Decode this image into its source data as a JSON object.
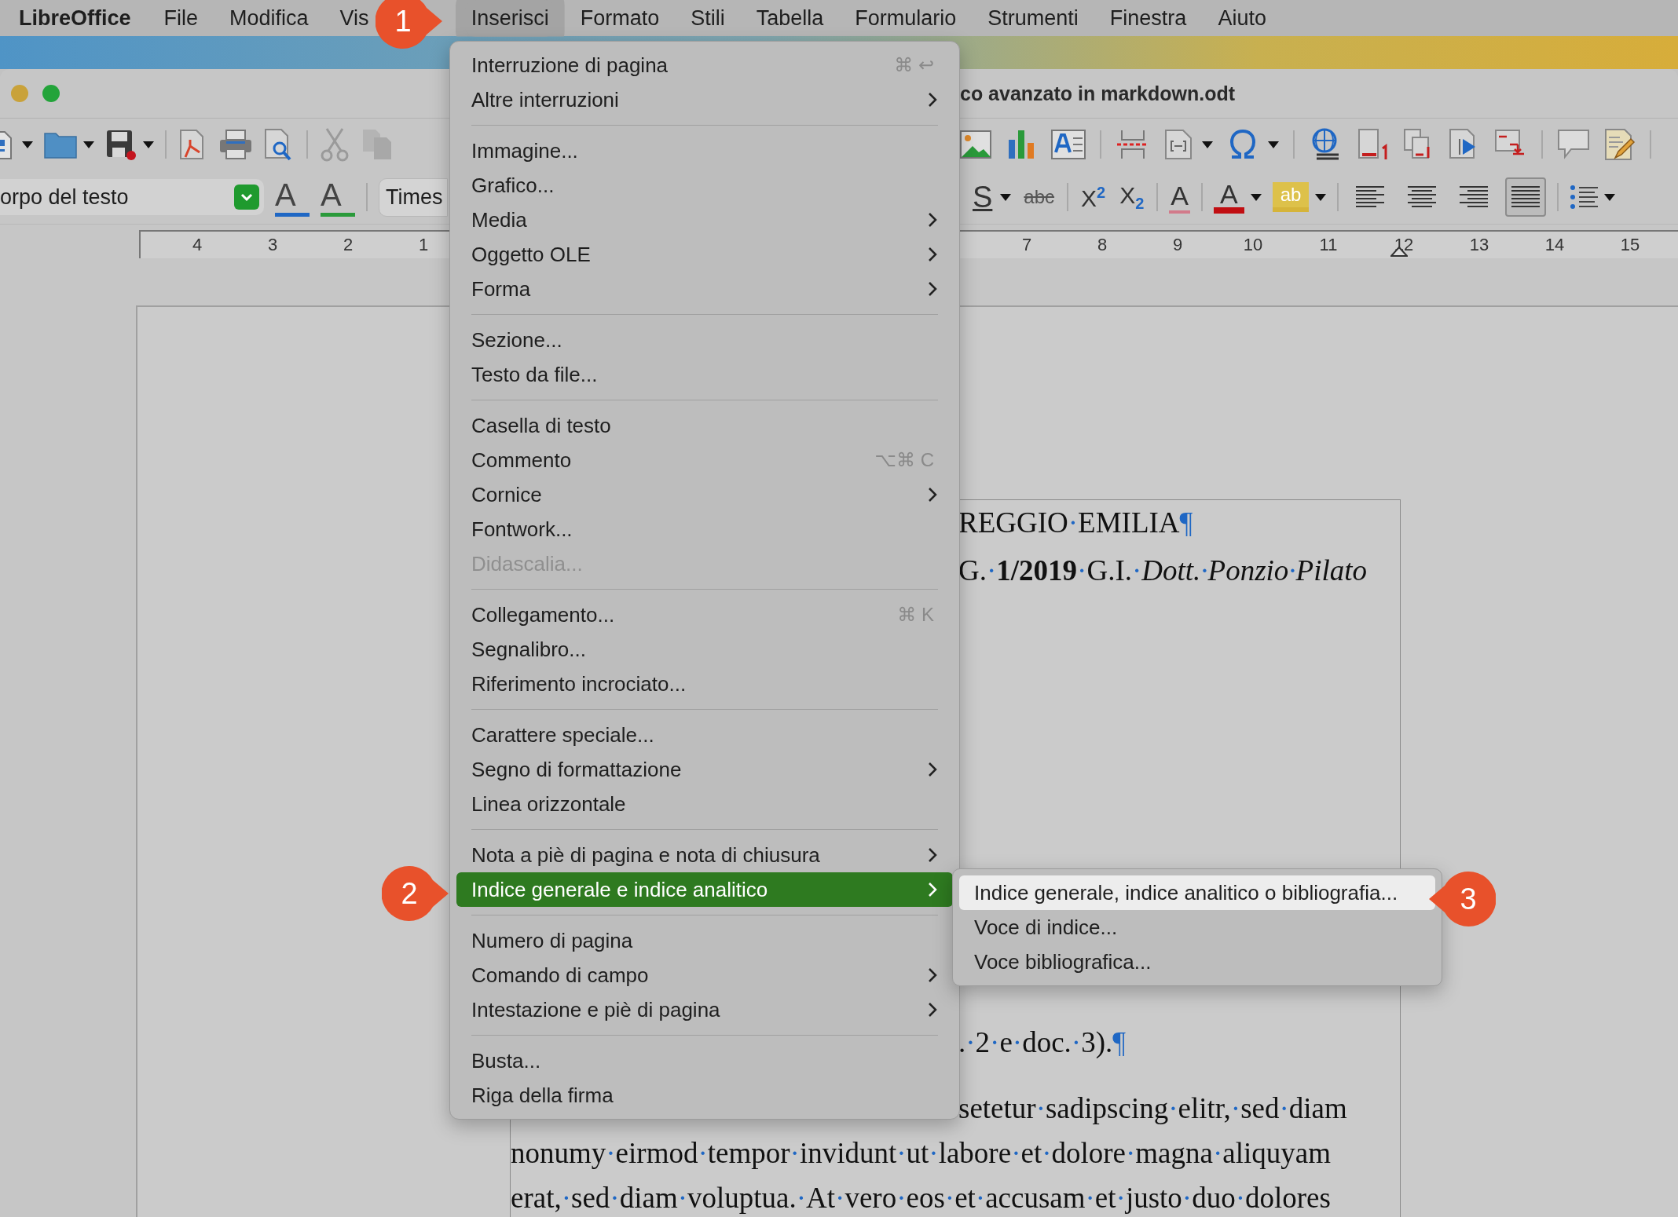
{
  "menu_bar": {
    "app_name": "LibreOffice",
    "menus": [
      {
        "label": "File",
        "selected": false
      },
      {
        "label": "Modifica",
        "selected": false
      },
      {
        "label": "Vis",
        "selected": false
      },
      {
        "label": "Inserisci",
        "selected": true
      },
      {
        "label": "Formato",
        "selected": false
      },
      {
        "label": "Stili",
        "selected": false
      },
      {
        "label": "Tabella",
        "selected": false
      },
      {
        "label": "Formulario",
        "selected": false
      },
      {
        "label": "Strumenti",
        "selected": false
      },
      {
        "label": "Finestra",
        "selected": false
      },
      {
        "label": "Aiuto",
        "selected": false
      }
    ]
  },
  "window": {
    "title": "co avanzato in markdown.odt"
  },
  "format_toolbar": {
    "paragraph_style": "orpo del testo",
    "font_name": "Times",
    "style_glyphs": [
      {
        "text": "A",
        "kind": "update"
      },
      {
        "text": "A",
        "kind": "new"
      }
    ],
    "glyphs": [
      {
        "text": "S",
        "kind": "underline"
      },
      {
        "text": "abc",
        "kind": "strike"
      },
      {
        "text": "X$^{2}$",
        "kind": "super"
      },
      {
        "text": "X$_{2}$",
        "kind": "sub"
      },
      {
        "text": "A",
        "kind": "clear"
      },
      {
        "text": "A",
        "kind": "color"
      },
      {
        "text": "ab",
        "kind": "highlight"
      }
    ],
    "align_buttons": [
      {
        "selected": false
      },
      {
        "selected": false
      },
      {
        "selected": false
      },
      {
        "selected": true
      }
    ]
  },
  "ruler": {
    "left_numbers": [
      "4",
      "3",
      "2",
      "1"
    ],
    "right_numbers": [
      "7",
      "8",
      "9",
      "10",
      "11",
      "12",
      "13",
      "14",
      "15"
    ]
  },
  "insert_menu": {
    "groups": [
      [
        {
          "label": "Interruzione di pagina",
          "shortcut": "⌘ ↩",
          "submenu": false,
          "disabled": false,
          "selected": false
        },
        {
          "label": "Altre interruzioni",
          "submenu": true,
          "disabled": false,
          "selected": false
        }
      ],
      [
        {
          "label": "Immagine...",
          "submenu": false,
          "disabled": false,
          "selected": false
        },
        {
          "label": "Grafico...",
          "submenu": false,
          "disabled": false,
          "selected": false
        },
        {
          "label": "Media",
          "submenu": true,
          "disabled": false,
          "selected": false
        },
        {
          "label": "Oggetto OLE",
          "submenu": true,
          "disabled": false,
          "selected": false
        },
        {
          "label": "Forma",
          "submenu": true,
          "disabled": false,
          "selected": false
        }
      ],
      [
        {
          "label": "Sezione...",
          "submenu": false,
          "disabled": false,
          "selected": false
        },
        {
          "label": "Testo da file...",
          "submenu": false,
          "disabled": false,
          "selected": false
        }
      ],
      [
        {
          "label": "Casella di testo",
          "submenu": false,
          "disabled": false,
          "selected": false
        },
        {
          "label": "Commento",
          "shortcut": "⌥⌘ C",
          "submenu": false,
          "disabled": false,
          "selected": false
        },
        {
          "label": "Cornice",
          "submenu": true,
          "disabled": false,
          "selected": false
        },
        {
          "label": "Fontwork...",
          "submenu": false,
          "disabled": false,
          "selected": false
        },
        {
          "label": "Didascalia...",
          "submenu": false,
          "disabled": true,
          "selected": false
        }
      ],
      [
        {
          "label": "Collegamento...",
          "shortcut": "⌘ K",
          "submenu": false,
          "disabled": false,
          "selected": false
        },
        {
          "label": "Segnalibro...",
          "submenu": false,
          "disabled": false,
          "selected": false
        },
        {
          "label": "Riferimento incrociato...",
          "submenu": false,
          "disabled": false,
          "selected": false
        }
      ],
      [
        {
          "label": "Carattere speciale...",
          "submenu": false,
          "disabled": false,
          "selected": false
        },
        {
          "label": "Segno di formattazione",
          "submenu": true,
          "disabled": false,
          "selected": false
        },
        {
          "label": "Linea orizzontale",
          "submenu": false,
          "disabled": false,
          "selected": false
        }
      ],
      [
        {
          "label": "Nota a piè di pagina e nota di chiusura",
          "submenu": true,
          "disabled": false,
          "selected": false
        },
        {
          "label": "Indice generale e indice analitico",
          "submenu": true,
          "disabled": false,
          "selected": true
        }
      ],
      [
        {
          "label": "Numero di pagina",
          "submenu": false,
          "disabled": false,
          "selected": false
        },
        {
          "label": "Comando di campo",
          "submenu": true,
          "disabled": false,
          "selected": false
        },
        {
          "label": "Intestazione e piè di pagina",
          "submenu": true,
          "disabled": false,
          "selected": false
        }
      ],
      [
        {
          "label": "Busta...",
          "submenu": false,
          "disabled": false,
          "selected": false
        },
        {
          "label": "Riga della firma",
          "submenu": false,
          "disabled": false,
          "selected": false
        }
      ]
    ]
  },
  "index_submenu": [
    {
      "label": "Indice generale, indice analitico o bibliografia...",
      "selected": true
    },
    {
      "label": "Voce di indice...",
      "selected": false
    },
    {
      "label": "Voce bibliografica...",
      "selected": false
    }
  ],
  "callouts": [
    {
      "number": "1",
      "kind": "menu"
    },
    {
      "number": "2",
      "kind": "item"
    },
    {
      "number": "3",
      "kind": "subitem"
    }
  ],
  "document": {
    "top_lines": [
      "REGGIO·EMILIA¶",
      "G.·**1/2019**·G.I.·*Dott.·Ponzio·Pilato*"
    ],
    "middle_lines": [
      ".·2·e·doc.·3).¶",
      "setetur·sadipscing·elitr,·sed·diam"
    ],
    "full_lines": [
      "nonumy·eirmod·tempor·invidunt·ut·labore·et·dolore·magna·aliquyam",
      "erat,·sed·diam·voluptua.·At·vero·eos·et·accusam·et·justo·duo·dolores"
    ]
  }
}
